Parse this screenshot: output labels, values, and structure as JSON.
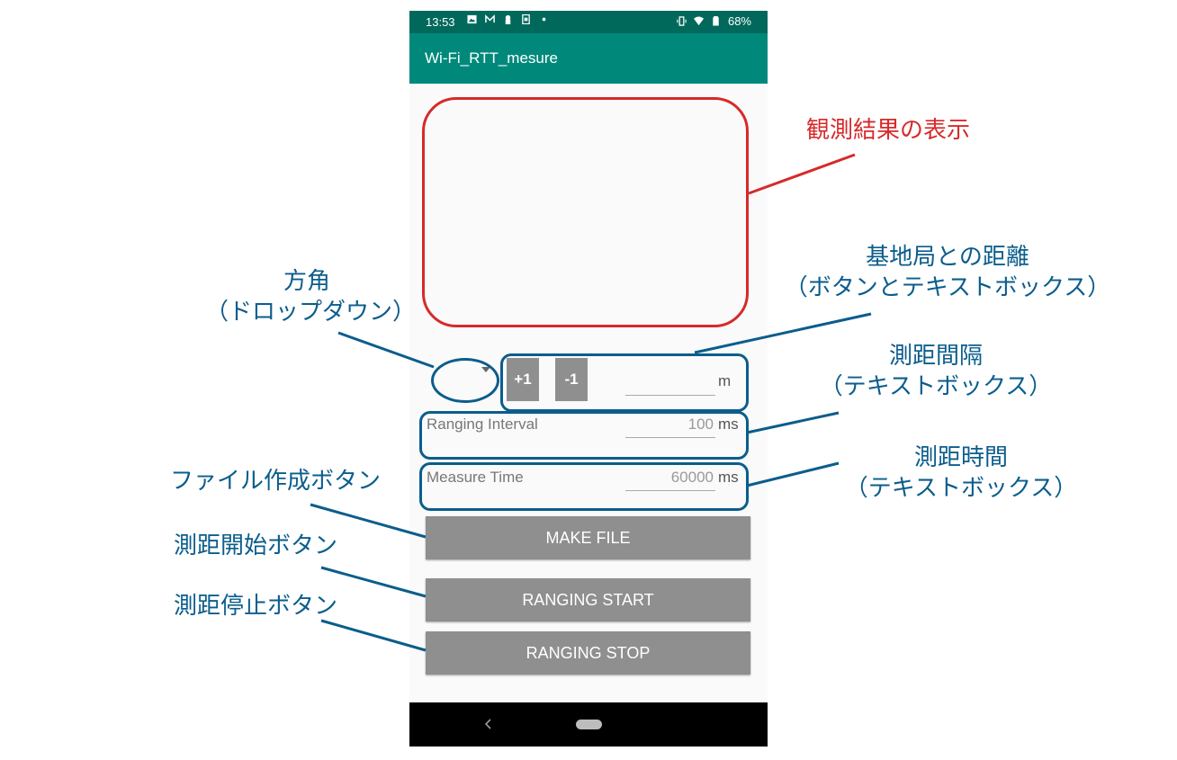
{
  "status_bar": {
    "time": "13:53",
    "battery": "68%",
    "icons": [
      "image-icon",
      "gmail-icon",
      "keyhole-icon",
      "sim-icon",
      "dot-icon",
      "vibrate-icon",
      "wifi-icon",
      "battery-icon"
    ]
  },
  "app_bar": {
    "title": "Wi-Fi_RTT_mesure"
  },
  "distance": {
    "plus_label": "+1",
    "minus_label": "-1",
    "value": "",
    "unit": "m"
  },
  "ranging_interval": {
    "hint": "Ranging Interval",
    "value": "100",
    "unit": "ms"
  },
  "measure_time": {
    "hint": "Measure Time",
    "value": "60000",
    "unit": "ms"
  },
  "buttons": {
    "make_file": "MAKE FILE",
    "ranging_start": "RANGING START",
    "ranging_stop": "RANGING STOP"
  },
  "nav_bar": {
    "back_icon": "back-chevron-icon",
    "home_icon": "home-pill-icon"
  },
  "annotations": {
    "result_display": "観測結果の表示",
    "direction_title": "方角",
    "direction_sub": "（ドロップダウン）",
    "distance_title": "基地局との距離",
    "distance_sub": "（ボタンとテキストボックス）",
    "interval_title": "測距間隔",
    "interval_sub": "（テキストボックス）",
    "time_title": "測距時間",
    "time_sub": "（テキストボックス）",
    "make_file": "ファイル作成ボタン",
    "start": "測距開始ボタン",
    "stop": "測距停止ボタン"
  },
  "colors": {
    "status_bar": "#00695c",
    "app_bar": "#00897b",
    "button": "#8f8f8f",
    "annotation_red": "#d62a2a",
    "annotation_blue": "#0b5d8c"
  }
}
